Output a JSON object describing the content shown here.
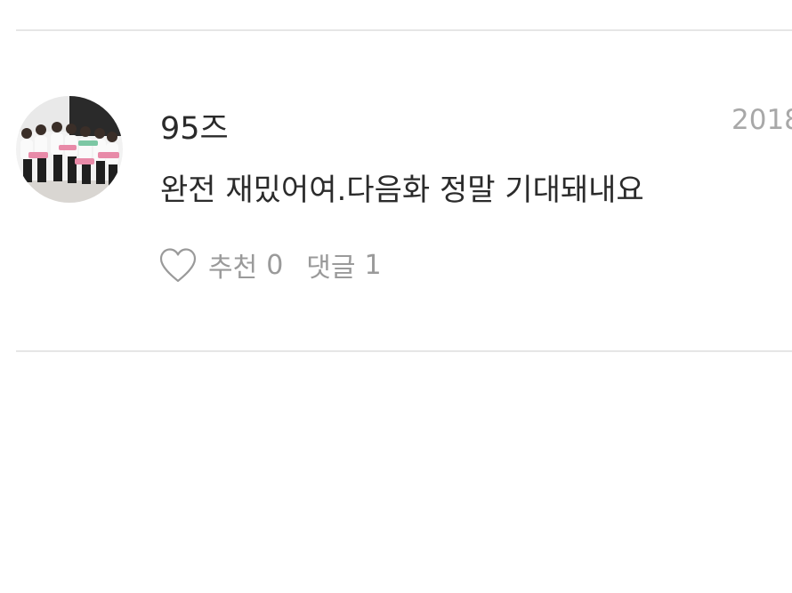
{
  "comment": {
    "author": "95즈",
    "timestamp": "2018",
    "text": "완전 재밌어여.다음화 정말 기대돼내요",
    "avatar_icon": "group-photo-avatar",
    "actions": {
      "like_icon": "heart-outline-icon",
      "like_label": "추천",
      "like_count": "0",
      "reply_label": "댓글",
      "reply_count": "1"
    }
  },
  "colors": {
    "divider": "#e6e6e6",
    "text_primary": "#2b2b2b",
    "text_muted": "#9a9a9a",
    "timestamp": "#a8a8a8"
  }
}
